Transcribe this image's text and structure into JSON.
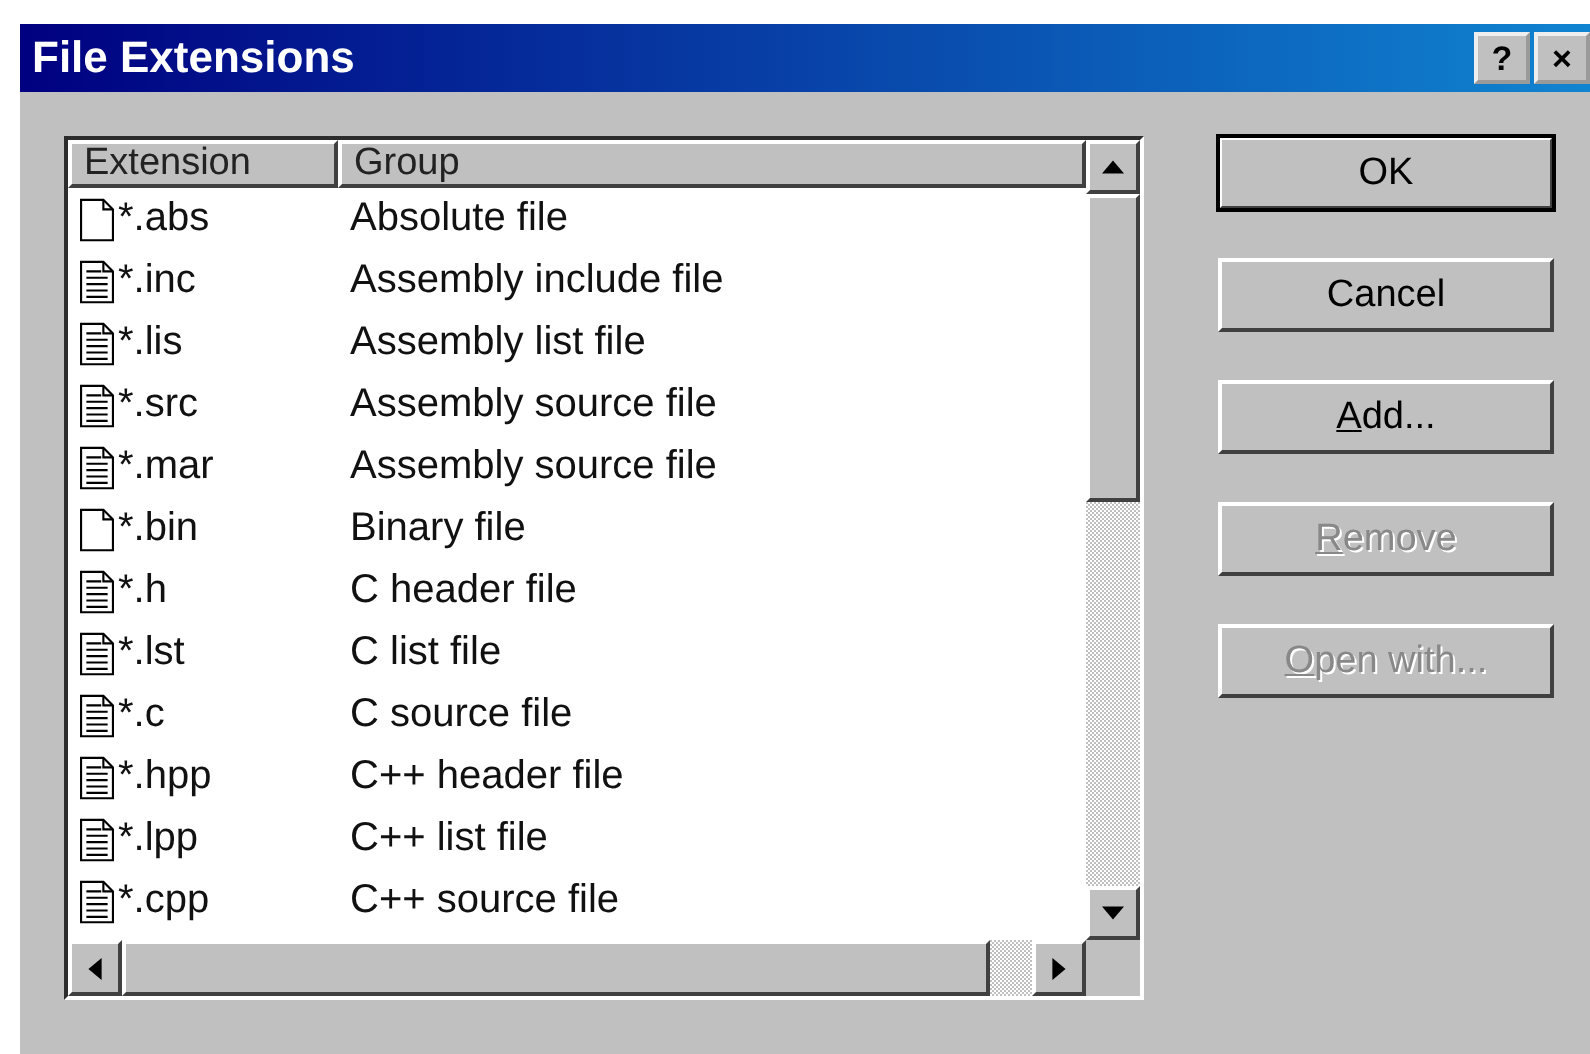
{
  "window": {
    "title": "File Extensions",
    "help_button": "?",
    "close_button": "×"
  },
  "list": {
    "columns": [
      "Extension",
      "Group"
    ],
    "rows": [
      {
        "kind": "blank",
        "extension": "*.abs",
        "group": "Absolute file"
      },
      {
        "kind": "text",
        "extension": "*.inc",
        "group": "Assembly include file"
      },
      {
        "kind": "text",
        "extension": "*.lis",
        "group": "Assembly list file"
      },
      {
        "kind": "text",
        "extension": "*.src",
        "group": "Assembly source file"
      },
      {
        "kind": "text",
        "extension": "*.mar",
        "group": "Assembly source file"
      },
      {
        "kind": "blank",
        "extension": "*.bin",
        "group": "Binary file"
      },
      {
        "kind": "text",
        "extension": "*.h",
        "group": "C header file"
      },
      {
        "kind": "text",
        "extension": "*.lst",
        "group": "C list file"
      },
      {
        "kind": "text",
        "extension": "*.c",
        "group": "C source file"
      },
      {
        "kind": "text",
        "extension": "*.hpp",
        "group": "C++ header file"
      },
      {
        "kind": "text",
        "extension": "*.lpp",
        "group": "C++ list file"
      },
      {
        "kind": "text",
        "extension": "*.cpp",
        "group": "C++ source file"
      }
    ]
  },
  "buttons": [
    {
      "label": "OK",
      "default": true,
      "disabled": false,
      "underline_first": false
    },
    {
      "label": "Cancel",
      "default": false,
      "disabled": false,
      "underline_first": false
    },
    {
      "label": "Add...",
      "default": false,
      "disabled": false,
      "underline_first": true
    },
    {
      "label": "Remove",
      "default": false,
      "disabled": true,
      "underline_first": true
    },
    {
      "label": "Open with...",
      "default": false,
      "disabled": true,
      "underline_first": true
    }
  ]
}
